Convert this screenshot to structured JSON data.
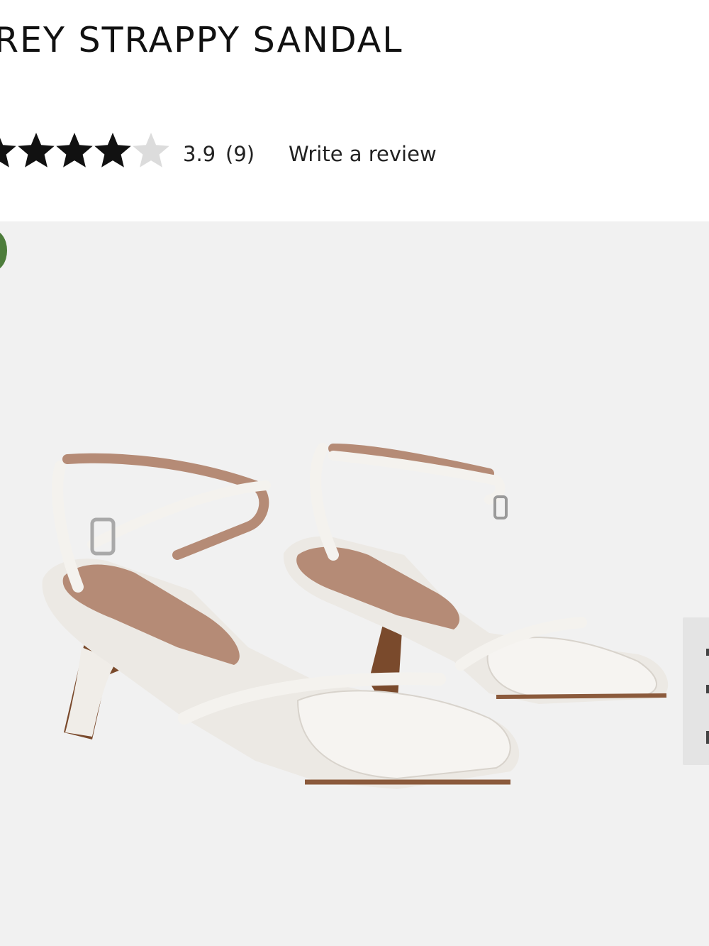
{
  "product": {
    "title": "REY STRAPPY SANDAL",
    "rating": {
      "stars_filled": 4,
      "stars_total": 5,
      "value": "3.9",
      "count": "(9)",
      "write_review_label": "Write a review"
    }
  },
  "image": {
    "alt": "White strappy block-heel sandals",
    "subject": "sandal-pair"
  },
  "colors": {
    "star_filled": "#111111",
    "star_empty": "#dcdcdc",
    "image_background": "#f1f1f1",
    "badge": "#4d7d3b",
    "side_panel": "#e4e4e4"
  }
}
